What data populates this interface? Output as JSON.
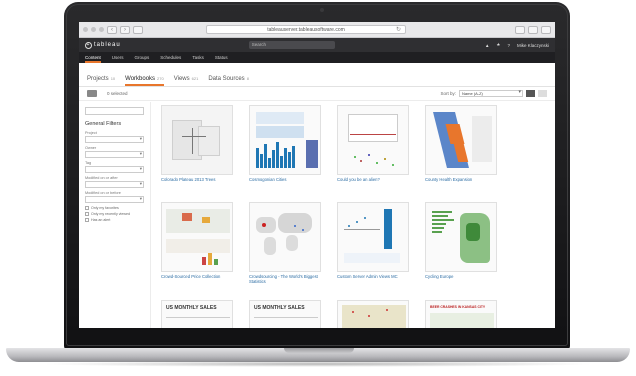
{
  "browser": {
    "url": "tableauserver.tableausoftware.com",
    "back_label": "‹",
    "forward_label": "›"
  },
  "header": {
    "logo_text": "tableau",
    "search_placeholder": "Search",
    "user_name": "Mike Klaczynski",
    "nav_tabs": [
      "Content",
      "Users",
      "Groups",
      "Schedules",
      "Tasks",
      "Status"
    ],
    "active_tab": "Content"
  },
  "content": {
    "tabs": [
      {
        "label": "Projects",
        "count": "10"
      },
      {
        "label": "Workbooks",
        "count": "270"
      },
      {
        "label": "Views",
        "count": "621"
      },
      {
        "label": "Data Sources",
        "count": "8"
      }
    ],
    "active_tab": "Workbooks",
    "selected_text": "0 selected",
    "sort_label": "Sort by:",
    "sort_value": "Name (A-Z)"
  },
  "sidebar": {
    "search_placeholder": "",
    "title": "General Filters",
    "filters": [
      "Project",
      "Owner",
      "Tag",
      "Modified on or after",
      "Modified on or before"
    ],
    "checkboxes": [
      "Only my favorites",
      "Only my recently viewed",
      "Has an alert"
    ]
  },
  "workbooks": [
    {
      "title": "Colorado Plateau 2013 Trees",
      "art": "map-lines"
    },
    {
      "title": "Cosmogonian Cities",
      "art": "blue-bars"
    },
    {
      "title": "Could you be an alien?",
      "art": "scatter"
    },
    {
      "title": "County Health Expansion",
      "art": "california"
    },
    {
      "title": "Crowd-Sourced Price Collection",
      "art": "colored-map"
    },
    {
      "title": "Crowdsourcing - The World's Biggest Statistics",
      "art": "world-map"
    },
    {
      "title": "Custom Server Admin Views MC",
      "art": "server-views"
    },
    {
      "title": "Cycling Europe",
      "art": "green-bars"
    },
    {
      "title": "",
      "art": "us-sales",
      "heading": "US MONTHLY SALES"
    },
    {
      "title": "",
      "art": "us-sales",
      "heading": "US MONTHLY SALES"
    },
    {
      "title": "",
      "art": "map-dots"
    },
    {
      "title": "",
      "art": "kansas",
      "heading": "BEER CRASHES IN KANSAS CITY"
    }
  ],
  "colors": {
    "accent": "#e8762c",
    "link": "#2b6ca3",
    "nav_dark": "#2f2f32",
    "chart_blue": "#1f77b4"
  }
}
